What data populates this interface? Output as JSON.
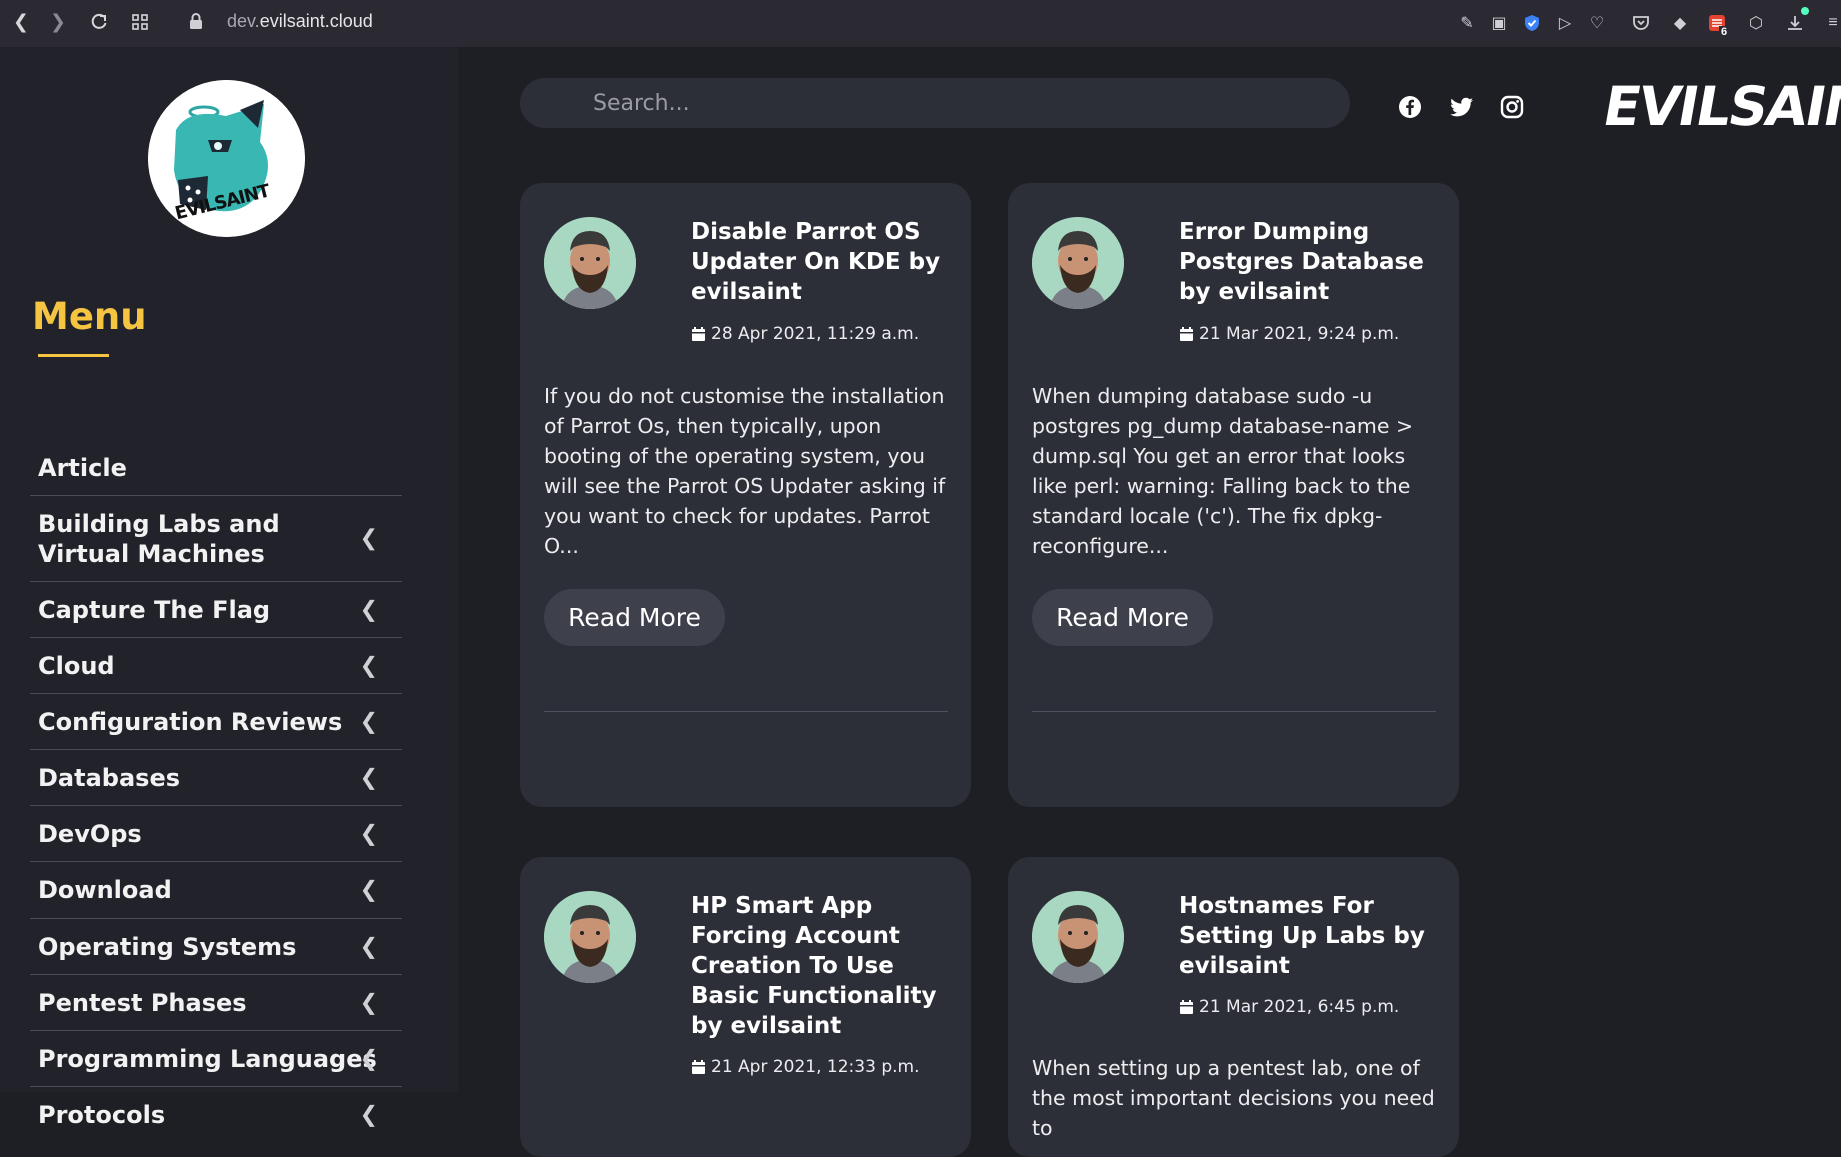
{
  "browser": {
    "url_host": "dev.",
    "url_domain": "evilsaint.cloud",
    "extension_badge": "6"
  },
  "sidebar": {
    "logo_text": "EVILSAINT",
    "menu_title": "Menu",
    "items": [
      {
        "label": "Article",
        "has_children": false
      },
      {
        "label": "Building Labs and Virtual Machines",
        "has_children": true
      },
      {
        "label": "Capture The Flag",
        "has_children": true
      },
      {
        "label": "Cloud",
        "has_children": true
      },
      {
        "label": "Configuration Reviews",
        "has_children": true
      },
      {
        "label": "Databases",
        "has_children": true
      },
      {
        "label": "DevOps",
        "has_children": true
      },
      {
        "label": "Download",
        "has_children": true
      },
      {
        "label": "Operating Systems",
        "has_children": true
      },
      {
        "label": "Pentest Phases",
        "has_children": true
      },
      {
        "label": "Programming Languages",
        "has_children": true
      },
      {
        "label": "Protocols",
        "has_children": true
      }
    ]
  },
  "header": {
    "search_placeholder": "Search...",
    "brand": "EVILSAINT"
  },
  "posts": [
    {
      "title": "Disable Parrot OS Updater On KDE by evilsaint",
      "date": "28 Apr 2021, 11:29 a.m.",
      "excerpt": "If you do not customise the installation of Parrot Os, then typically, upon booting of the operating system, you will see the Parrot OS Updater asking if you want to check for updates. Parrot O...",
      "button": "Read More"
    },
    {
      "title": "Error Dumping Postgres Database by evilsaint",
      "date": "21 Mar 2021, 9:24 p.m.",
      "excerpt": "When dumping database sudo -u postgres pg_dump database-name > dump.sql You get an error that looks like perl: warning: Falling back to the standard locale ('c'). The fix dpkg-reconfigure...",
      "button": "Read More"
    },
    {
      "title": "HP Smart App Forcing Account Creation To Use Basic Functionality by evilsaint",
      "date": "21 Apr 2021, 12:33 p.m."
    },
    {
      "title": "Hostnames For Setting Up Labs by evilsaint",
      "date": "21 Mar 2021, 6:45 p.m.",
      "excerpt": "When setting up a pentest lab, one of the most important decisions you need to"
    }
  ],
  "colors": {
    "accent": "#f5c542",
    "sidebar_bg": "#22232a",
    "main_bg": "#1e1f24",
    "card_bg": "#2d2f38"
  }
}
